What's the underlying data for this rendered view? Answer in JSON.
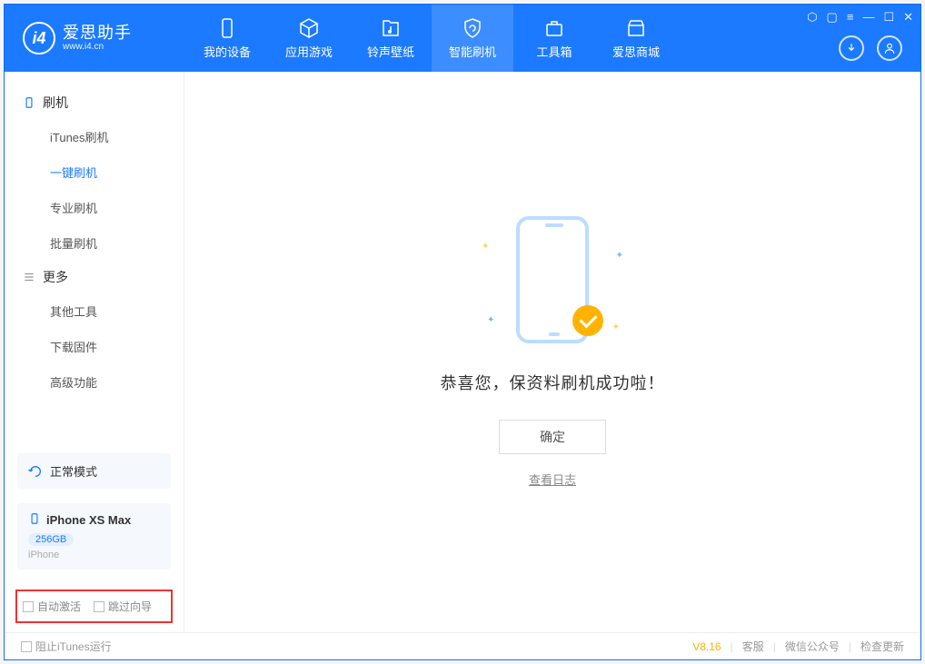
{
  "app": {
    "name": "爱思助手",
    "url": "www.i4.cn"
  },
  "nav": {
    "device": "我的设备",
    "apps": "应用游戏",
    "ring": "铃声壁纸",
    "flash": "智能刷机",
    "tools": "工具箱",
    "store": "爱思商城"
  },
  "sidebar": {
    "section_flash": "刷机",
    "items": {
      "itunes": "iTunes刷机",
      "onekey": "一键刷机",
      "pro": "专业刷机",
      "batch": "批量刷机"
    },
    "section_more": "更多",
    "more": {
      "other": "其他工具",
      "firmware": "下载固件",
      "adv": "高级功能"
    },
    "mode_label": "正常模式",
    "device": {
      "name": "iPhone XS Max",
      "capacity": "256GB",
      "type": "iPhone"
    },
    "check_auto": "自动激活",
    "check_skip": "跳过向导"
  },
  "main": {
    "message": "恭喜您，保资料刷机成功啦！",
    "ok": "确定",
    "view_log": "查看日志"
  },
  "status": {
    "block_itunes": "阻止iTunes运行",
    "version": "V8.16",
    "svc": "客服",
    "wechat": "微信公众号",
    "update": "检查更新"
  }
}
